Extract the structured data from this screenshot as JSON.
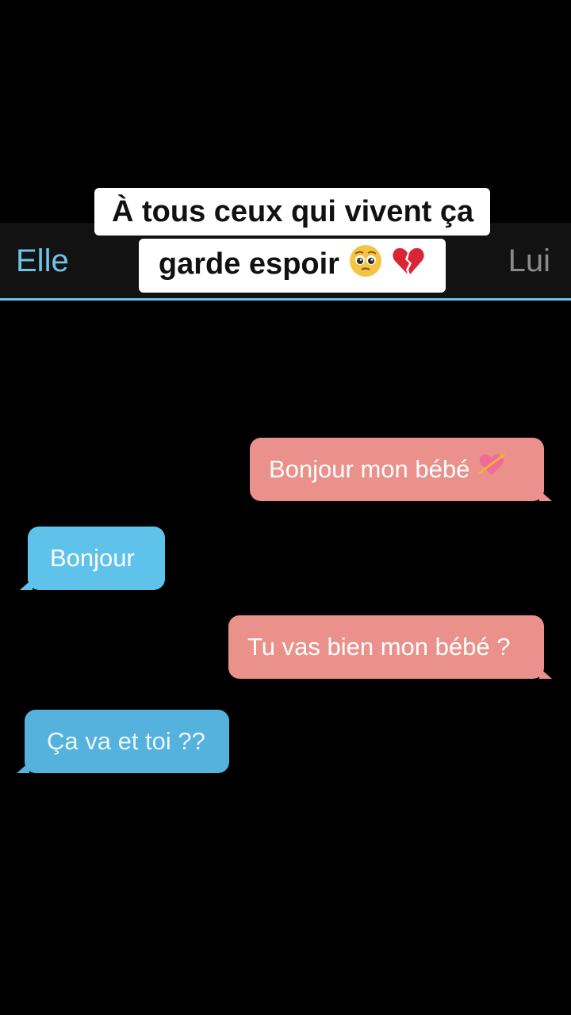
{
  "tabs": {
    "left_label": "Elle",
    "right_label": "Lui",
    "left_color": "#6ec3e8",
    "right_color": "#8a8a8a"
  },
  "caption": {
    "line1": "À tous ceux qui vivent ça",
    "line2": "garde espoir",
    "line2_emojis": [
      "pleading-face-icon",
      "broken-heart-icon"
    ]
  },
  "messages": [
    {
      "sender": "Lui",
      "side": "right",
      "text": "Bonjour mon bébé",
      "emoji": "heart-with-arrow-icon",
      "color": "#e9918a"
    },
    {
      "sender": "Elle",
      "side": "left",
      "text": "Bonjour",
      "color": "#5ec2ea"
    },
    {
      "sender": "Lui",
      "side": "right",
      "text": "Tu vas bien mon bébé ?",
      "color": "#e9918a"
    },
    {
      "sender": "Elle",
      "side": "left",
      "text": "Ça va et toi ??",
      "color": "#54b2dc"
    }
  ]
}
